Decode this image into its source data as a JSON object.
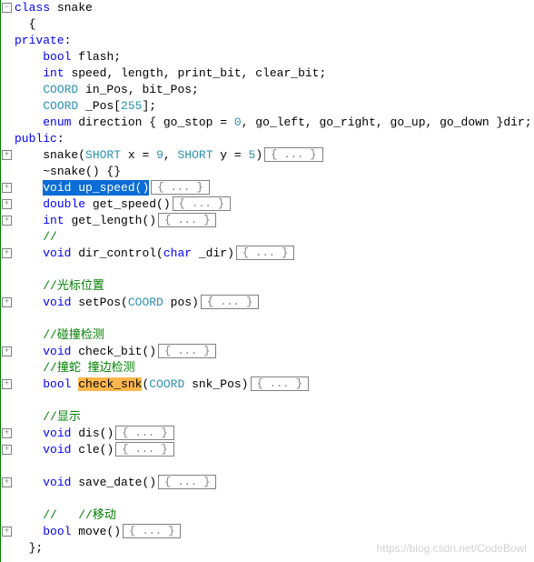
{
  "fold_placeholder": "{ ... }",
  "watermark": "https://blog.csdn.net/CodeBowl",
  "lines": [
    {
      "fold": "-",
      "tokens": [
        {
          "t": "class ",
          "c": "kw"
        },
        {
          "t": "snake",
          "c": "id"
        }
      ]
    },
    {
      "fold": null,
      "indent": "  ",
      "tokens": [
        {
          "t": "{",
          "c": "id"
        }
      ]
    },
    {
      "fold": null,
      "tokens": [
        {
          "t": "private",
          "c": "kw"
        },
        {
          "t": ":",
          "c": "id"
        }
      ]
    },
    {
      "fold": null,
      "indent": "    ",
      "tokens": [
        {
          "t": "bool ",
          "c": "kw"
        },
        {
          "t": "flash;",
          "c": "id"
        }
      ]
    },
    {
      "fold": null,
      "indent": "    ",
      "tokens": [
        {
          "t": "int ",
          "c": "kw"
        },
        {
          "t": "speed, length, print_bit, clear_bit;",
          "c": "id"
        }
      ]
    },
    {
      "fold": null,
      "indent": "    ",
      "tokens": [
        {
          "t": "COORD ",
          "c": "type"
        },
        {
          "t": "in_Pos, bit_Pos;",
          "c": "id"
        }
      ]
    },
    {
      "fold": null,
      "indent": "    ",
      "tokens": [
        {
          "t": "COORD ",
          "c": "type"
        },
        {
          "t": "_Pos[",
          "c": "id"
        },
        {
          "t": "255",
          "c": "num"
        },
        {
          "t": "];",
          "c": "id"
        }
      ]
    },
    {
      "fold": null,
      "indent": "    ",
      "tokens": [
        {
          "t": "enum ",
          "c": "kw"
        },
        {
          "t": "direction ",
          "c": "id"
        },
        {
          "t": "{ go_stop = ",
          "c": "id"
        },
        {
          "t": "0",
          "c": "num"
        },
        {
          "t": ", go_left, go_right, go_up, go_down }dir;",
          "c": "id"
        }
      ]
    },
    {
      "fold": null,
      "tokens": [
        {
          "t": "public",
          "c": "kw"
        },
        {
          "t": ":",
          "c": "id"
        }
      ]
    },
    {
      "fold": "+",
      "indent": "    ",
      "tokens": [
        {
          "t": "snake(",
          "c": "id"
        },
        {
          "t": "SHORT ",
          "c": "type"
        },
        {
          "t": "x = ",
          "c": "id"
        },
        {
          "t": "9",
          "c": "num"
        },
        {
          "t": ", ",
          "c": "id"
        },
        {
          "t": "SHORT ",
          "c": "type"
        },
        {
          "t": "y = ",
          "c": "id"
        },
        {
          "t": "5",
          "c": "num"
        },
        {
          "t": ")",
          "c": "id"
        }
      ],
      "foldbox": true
    },
    {
      "fold": null,
      "indent": "    ",
      "tokens": [
        {
          "t": "~snake() {}",
          "c": "id"
        }
      ]
    },
    {
      "fold": "+",
      "indent": "    ",
      "selected": true,
      "tokens": [
        {
          "t": "void ",
          "c": "kw"
        },
        {
          "t": "up_speed()",
          "c": "id"
        }
      ],
      "foldbox": true
    },
    {
      "fold": "+",
      "indent": "    ",
      "tokens": [
        {
          "t": "double ",
          "c": "kw"
        },
        {
          "t": "get_speed()",
          "c": "id"
        }
      ],
      "foldbox": true
    },
    {
      "fold": "+",
      "indent": "    ",
      "tokens": [
        {
          "t": "int ",
          "c": "kw"
        },
        {
          "t": "get_length()",
          "c": "id"
        }
      ],
      "foldbox": true
    },
    {
      "fold": null,
      "indent": "    ",
      "tokens": [
        {
          "t": "//",
          "c": "cmt"
        }
      ]
    },
    {
      "fold": "+",
      "indent": "    ",
      "tokens": [
        {
          "t": "void ",
          "c": "kw"
        },
        {
          "t": "dir_control(",
          "c": "id"
        },
        {
          "t": "char ",
          "c": "kw"
        },
        {
          "t": "_dir)",
          "c": "id"
        }
      ],
      "foldbox": true
    },
    {
      "fold": null,
      "indent": "    ",
      "tokens": [
        {
          "t": "",
          "c": "id"
        }
      ]
    },
    {
      "fold": null,
      "indent": "    ",
      "tokens": [
        {
          "t": "//光标位置",
          "c": "cmt"
        }
      ]
    },
    {
      "fold": "+",
      "indent": "    ",
      "tokens": [
        {
          "t": "void ",
          "c": "kw"
        },
        {
          "t": "setPos(",
          "c": "id"
        },
        {
          "t": "COORD ",
          "c": "type"
        },
        {
          "t": "pos)",
          "c": "id"
        }
      ],
      "foldbox": true
    },
    {
      "fold": null,
      "indent": "    ",
      "tokens": [
        {
          "t": "",
          "c": "id"
        }
      ]
    },
    {
      "fold": null,
      "indent": "    ",
      "tokens": [
        {
          "t": "//碰撞检测",
          "c": "cmt"
        }
      ]
    },
    {
      "fold": "+",
      "indent": "    ",
      "tokens": [
        {
          "t": "void ",
          "c": "kw"
        },
        {
          "t": "check_bit()",
          "c": "id"
        }
      ],
      "foldbox": true
    },
    {
      "fold": null,
      "indent": "    ",
      "tokens": [
        {
          "t": "//撞蛇 撞边检测",
          "c": "cmt"
        }
      ]
    },
    {
      "fold": "+",
      "indent": "    ",
      "tokens": [
        {
          "t": "bool ",
          "c": "kw"
        },
        {
          "t": "check_snk",
          "c": "id",
          "hl": true
        },
        {
          "t": "(",
          "c": "id"
        },
        {
          "t": "COORD ",
          "c": "type"
        },
        {
          "t": "snk_Pos)",
          "c": "id"
        }
      ],
      "foldbox": true
    },
    {
      "fold": null,
      "indent": "    ",
      "tokens": [
        {
          "t": "",
          "c": "id"
        }
      ]
    },
    {
      "fold": null,
      "indent": "    ",
      "tokens": [
        {
          "t": "//显示",
          "c": "cmt"
        }
      ]
    },
    {
      "fold": "+",
      "indent": "    ",
      "tokens": [
        {
          "t": "void ",
          "c": "kw"
        },
        {
          "t": "dis()",
          "c": "id"
        }
      ],
      "foldbox": true
    },
    {
      "fold": "+",
      "indent": "    ",
      "tokens": [
        {
          "t": "void ",
          "c": "kw"
        },
        {
          "t": "cle()",
          "c": "id"
        }
      ],
      "foldbox": true
    },
    {
      "fold": null,
      "indent": "    ",
      "tokens": [
        {
          "t": "",
          "c": "id"
        }
      ]
    },
    {
      "fold": "+",
      "indent": "    ",
      "tokens": [
        {
          "t": "void ",
          "c": "kw"
        },
        {
          "t": "save_date()",
          "c": "id"
        }
      ],
      "foldbox": true
    },
    {
      "fold": null,
      "indent": "    ",
      "tokens": [
        {
          "t": "",
          "c": "id"
        }
      ]
    },
    {
      "fold": null,
      "indent": "    ",
      "tokens": [
        {
          "t": "//   //移动",
          "c": "cmt"
        }
      ]
    },
    {
      "fold": "+",
      "indent": "    ",
      "tokens": [
        {
          "t": "bool ",
          "c": "kw"
        },
        {
          "t": "move()",
          "c": "id"
        }
      ],
      "foldbox": true
    },
    {
      "fold": null,
      "indent": "  ",
      "tokens": [
        {
          "t": "};",
          "c": "id"
        }
      ]
    }
  ]
}
